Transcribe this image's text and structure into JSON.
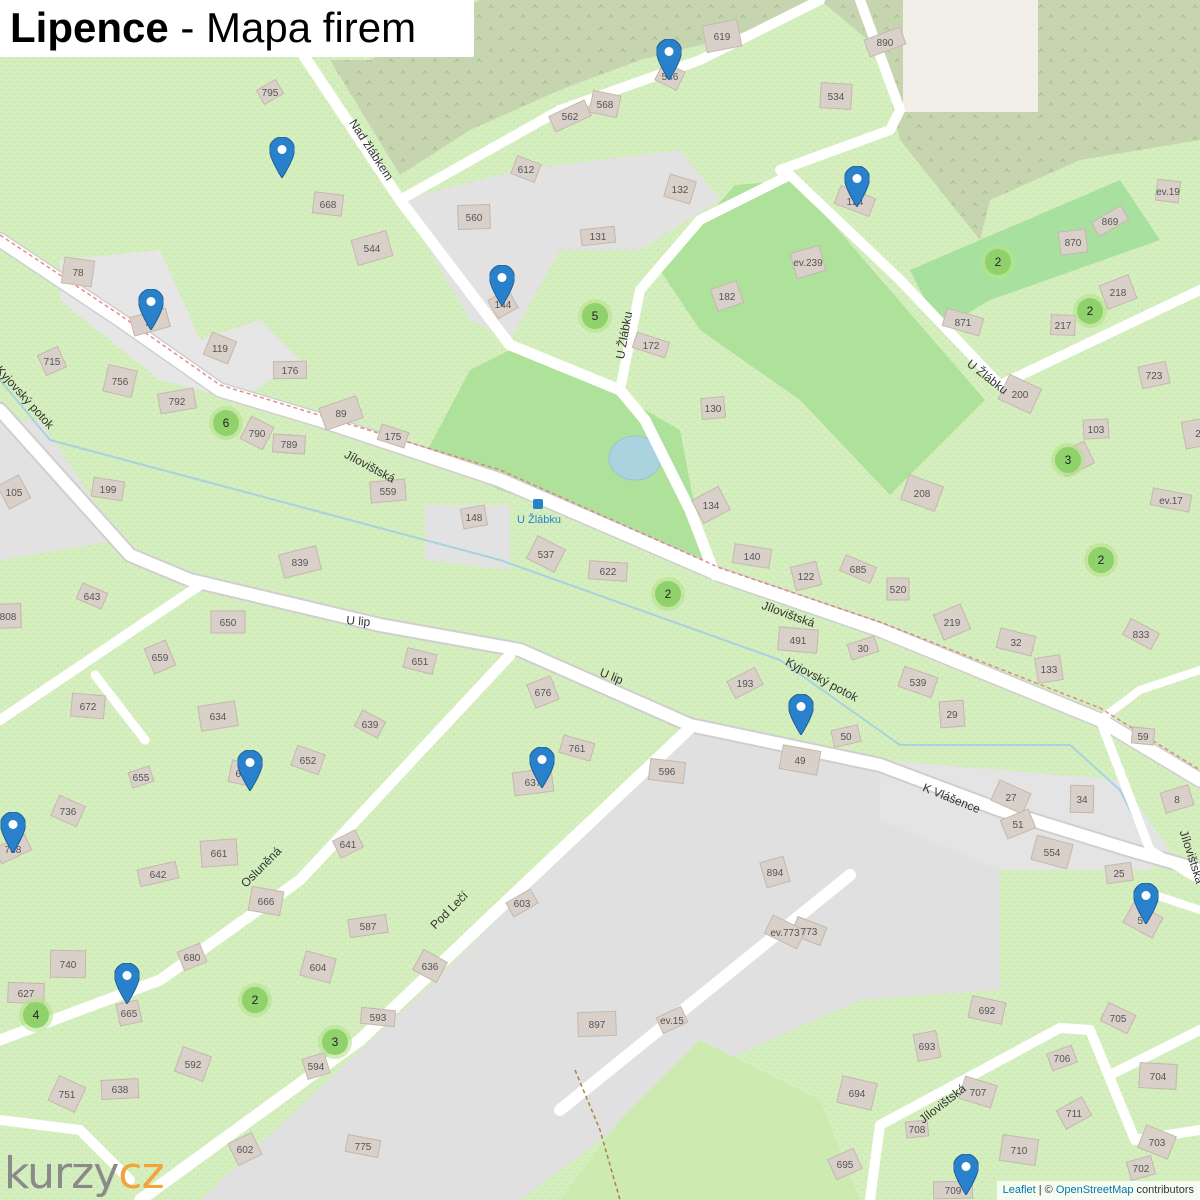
{
  "header": {
    "title_bold": "Lipence",
    "title_rest": " - Mapa firem"
  },
  "logo": {
    "part1": "kurzy",
    "part2": "cz"
  },
  "attribution": {
    "leaflet": "Leaflet",
    "sep": " | © ",
    "osm": "OpenStreetMap",
    "contrib": " contributors"
  },
  "stop": {
    "name": "U Žlábku"
  },
  "streets": {
    "jilovistska_1": "Jílovištská",
    "jilovistska_2": "Jílovištská",
    "jilovistska_3": "Jílovištská",
    "jilovistska_4": "Jílovištská",
    "nad_zlabkem": "Nad žlábkem",
    "u_zlabku_1": "U Žlábku",
    "u_zlabku_2": "U Žlábku",
    "u_lip_1": "U lip",
    "u_lip_2": "U lip",
    "oslunena": "Osluněná",
    "pod_leci": "Pod Lečí",
    "k_vlasence": "K Vlášence",
    "kyjovsky_1": "Kyjovský potok",
    "kyjovsky_2": "Kyjovský potok"
  },
  "clusters": [
    "6",
    "5",
    "2",
    "2",
    "2",
    "3",
    "2",
    "2",
    "4",
    "3"
  ],
  "buildings": [
    "795",
    "668",
    "544",
    "612",
    "560",
    "562",
    "568",
    "619",
    "546",
    "534",
    "890",
    "132",
    "131",
    "144",
    "78",
    "79",
    "119",
    "176",
    "715",
    "756",
    "792",
    "790",
    "789",
    "89",
    "175",
    "559",
    "105",
    "199",
    "839",
    "643",
    "650",
    "659",
    "651",
    "634",
    "639",
    "672",
    "655",
    "652",
    "661",
    "641",
    "666",
    "642",
    "736",
    "740",
    "680",
    "604",
    "587",
    "636",
    "593",
    "594",
    "592",
    "638",
    "602",
    "775",
    "665",
    "751",
    "627",
    "676",
    "761",
    "637",
    "603",
    "596",
    "894",
    "773",
    "897",
    "ev.15",
    "692",
    "693",
    "705",
    "704",
    "706",
    "707",
    "708",
    "711",
    "710",
    "702",
    "703",
    "709",
    "695",
    "694",
    "148",
    "537",
    "622",
    "182",
    "172",
    "130",
    "134",
    "140",
    "122",
    "685",
    "520",
    "219",
    "32",
    "133",
    "833",
    "491",
    "30",
    "539",
    "29",
    "193",
    "49",
    "50",
    "27",
    "34",
    "51",
    "554",
    "25",
    "57",
    "59",
    "8",
    "208",
    "103",
    "3",
    "ev.17",
    "723",
    "200",
    "217",
    "218",
    "871",
    "870",
    "869",
    "ev.19",
    "ev.239",
    "124",
    "808",
    "788",
    "62",
    "2",
    "ev.773"
  ],
  "colors": {
    "green_area": "#d7efc2",
    "park": "#a8e0a0",
    "road": "#ffffff",
    "building": "#d8cfc6",
    "marker": "#2a81cb",
    "cluster": "#8fd16b",
    "water": "#aad3df"
  }
}
